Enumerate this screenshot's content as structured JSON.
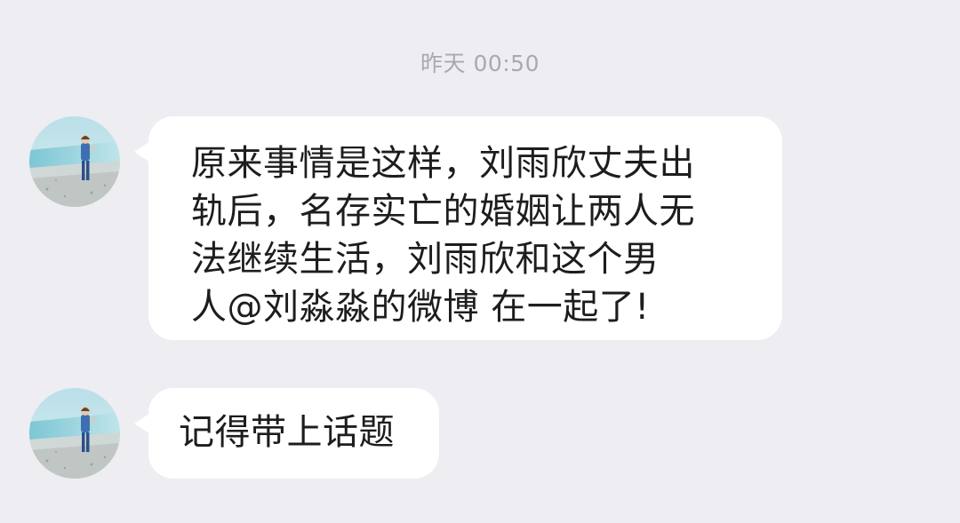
{
  "chat": {
    "timestamp": "昨天 00:50",
    "messages": [
      {
        "sender": "contact",
        "avatar_icon": "beach-person-photo",
        "lines": [
          "原来事情是这样，刘雨欣丈夫出",
          "轨后，名存实亡的婚姻让两人无",
          "法继续生活，刘雨欣和这个男",
          "人@刘淼淼的微博 在一起了!"
        ]
      },
      {
        "sender": "contact",
        "avatar_icon": "beach-person-photo",
        "lines": [
          "记得带上话题"
        ]
      }
    ]
  },
  "colors": {
    "background": "#ededf2",
    "bubble": "#ffffff",
    "text": "#1d1d1f",
    "timestamp": "#a9a9ae"
  }
}
